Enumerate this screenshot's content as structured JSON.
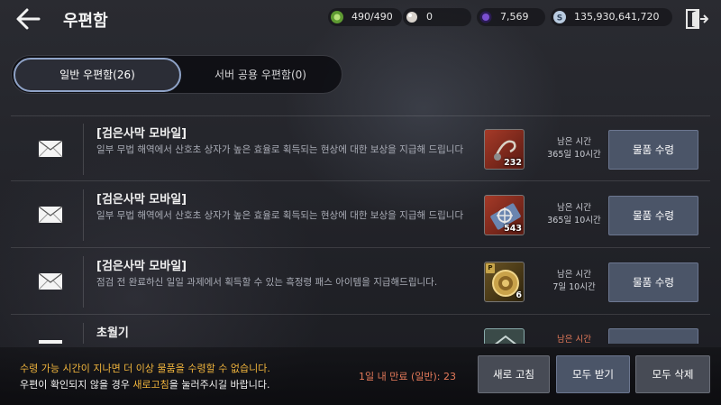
{
  "header": {
    "title": "우편함",
    "currencies": [
      {
        "icon": "energy-icon",
        "value": "490/490",
        "color": "#6fae3a"
      },
      {
        "icon": "pearl-icon",
        "value": "0",
        "color": "#d8d2cc"
      },
      {
        "icon": "black-stone-icon",
        "value": "7,569",
        "color": "#7a4fd0"
      },
      {
        "icon": "silver-icon",
        "value": "135,930,641,720",
        "color": "#b9cbe0"
      }
    ]
  },
  "tabs": [
    {
      "label": "일반 우편함(26)",
      "active": true
    },
    {
      "label": "서버 공용 우편함(0)",
      "active": false
    }
  ],
  "mails": [
    {
      "sender": "[검은사막 모바일]",
      "message": "일부 무법 해역에서 산호초 상자가 높은 효율로 획득되는 현상에 대한 보상을 지급해 드립니다",
      "item": {
        "icon": "fishing-hook-icon",
        "count": "232",
        "color": "#8a2a1e"
      },
      "time_label": "남은 시간",
      "time_value": "365일 10시간",
      "claim_label": "물품 수령"
    },
    {
      "sender": "[검은사막 모바일]",
      "message": "일부 무법 해역에서 산호초 상자가 높은 효율로 획득되는 현상에 대한 보상을 지급해 드립니다",
      "item": {
        "icon": "compass-ticket-icon",
        "count": "543",
        "color": "#8a2a1e"
      },
      "time_label": "남은 시간",
      "time_value": "365일 10시간",
      "claim_label": "물품 수령"
    },
    {
      "sender": "[검은사막 모바일]",
      "message": "점검 전 완료하신 일일 과제에서 획득할 수 있는 흑정령 패스 아이템을 지급해드립니다.",
      "item": {
        "icon": "gold-coin-icon",
        "count": "6",
        "badge": "P",
        "color": "#5a4a1c"
      },
      "time_label": "남은 시간",
      "time_value": "7일 10시간",
      "claim_label": "물품 수령"
    },
    {
      "sender": "초월기",
      "message": "",
      "item": {
        "icon": "item-icon",
        "count": "",
        "color": "#3a4a48"
      },
      "time_label": "남은 시간",
      "time_value": "",
      "claim_label": ""
    }
  ],
  "footer": {
    "notice_line1": "수령 가능 시간이 지나면 더 이상 물품을 수령할 수 없습니다.",
    "notice_line2_pre": "우편이 확인되지 않을 경우 ",
    "notice_line2_highlight": "새로고침",
    "notice_line2_post": "을 눌러주시길 바랍니다.",
    "expire_text": "1일 내 만료 (일반): 23",
    "refresh_label": "새로 고침",
    "take_all_label": "모두 받기",
    "delete_all_label": "모두 삭제"
  }
}
